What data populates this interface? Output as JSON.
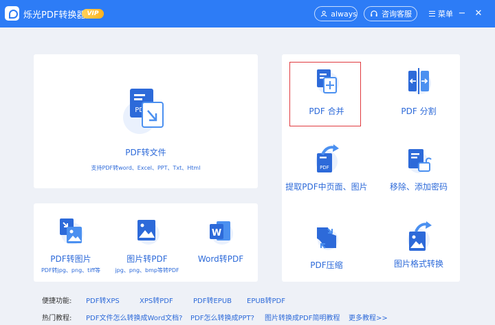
{
  "app": {
    "title": "烁光PDF转换器",
    "vip": "VIP"
  },
  "titlebar": {
    "user": "always",
    "support": "咨询客服",
    "menu": "菜单",
    "minimize": "−",
    "close": "✕"
  },
  "main_tool": {
    "label": "PDF转文件",
    "sub": "支持PDF转word、Excel、PPT、Txt、Html",
    "icon_text": "PDF"
  },
  "small_tools": [
    {
      "label": "PDF转图片",
      "sub": "PDF转jpg、png、tiff等"
    },
    {
      "label": "图片转PDF",
      "sub": "jpg、png、bmp等转PDF"
    },
    {
      "label": "Word转PDF",
      "sub": "",
      "icon_text": "W"
    }
  ],
  "right_tools": [
    {
      "label": "PDF 合并"
    },
    {
      "label": "PDF 分割"
    },
    {
      "label": "提取PDF中页面、图片",
      "icon_text": "PDF"
    },
    {
      "label": "移除、添加密码"
    },
    {
      "label": "PDF压缩"
    },
    {
      "label": "图片格式转换"
    }
  ],
  "shortcuts": {
    "label": "便捷功能:",
    "links": [
      "PDF转XPS",
      "XPS转PDF",
      "PDF转EPUB",
      "EPUB转PDF"
    ]
  },
  "tutorials": {
    "label": "热门教程:",
    "links": [
      "PDF文件怎么转换成Word文档?",
      "PDF怎么转换成PPT?",
      "图片转换成PDF简明教程",
      "更多教程>>"
    ]
  },
  "colors": {
    "brand": "#2d7cf6",
    "link": "#2d6ad9",
    "selected_border": "#e0393e",
    "background": "#eef1f7"
  }
}
